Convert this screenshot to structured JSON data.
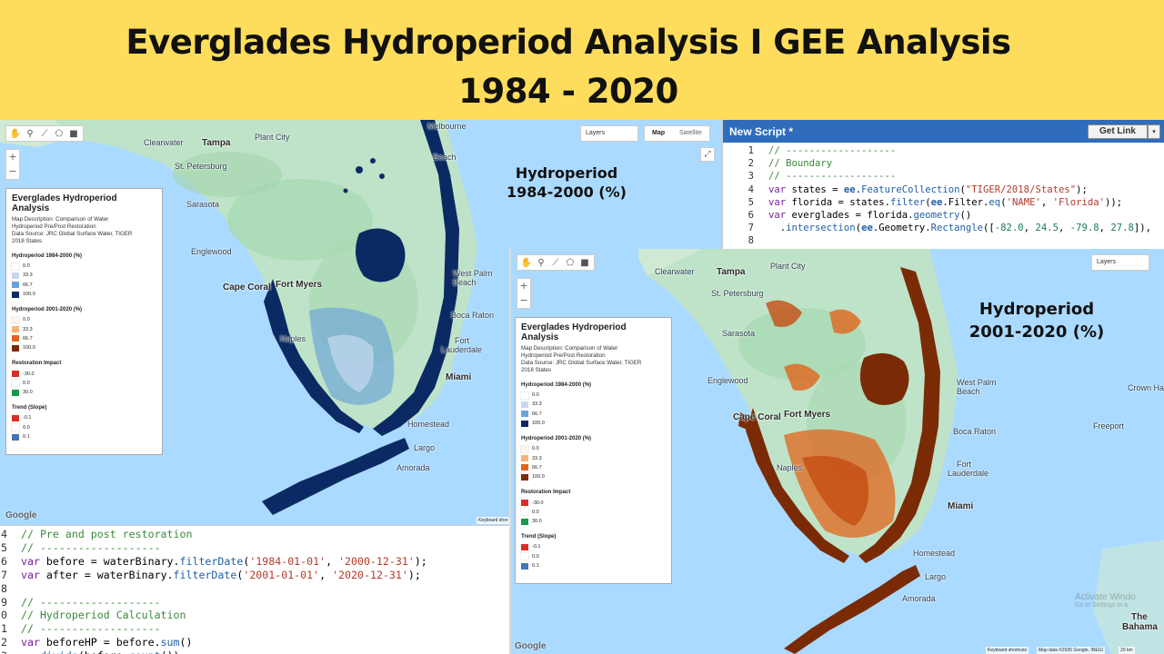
{
  "banner": {
    "title_line1": "Everglades Hydroperiod Analysis I GEE Analysis",
    "title_line2": "1984 - 2020",
    "color": "#fedd5c"
  },
  "overlay_labels": {
    "left": {
      "line1": "Hydroperiod",
      "line2": "1984-2000 (%)"
    },
    "right": {
      "line1": "Hydroperiod",
      "line2": "2001-2020 (%)"
    }
  },
  "map_ui": {
    "layers_label": "Layers",
    "map_label": "Map",
    "satellite_label": "Satellite",
    "zoom_in": "+",
    "zoom_out": "−",
    "google_logo": "Google",
    "keyboard_shortcuts": "Keyboard shortcuts",
    "keyboard_shortcuts_clipped": "Keyboard shor",
    "map_data": "Map data ©2026 Google, INEGI",
    "scale": "20 km"
  },
  "cities": {
    "left": [
      "Clearwater",
      "Tampa",
      "Plant City",
      "Melbourne",
      "St. Petersburg",
      "Sarasota",
      "Englewood",
      "Cape Coral",
      "Fort Myers",
      "Naples",
      "Beach",
      "West Palm",
      "Beach",
      "Boca Raton",
      "Fort",
      "Lauderdale",
      "Miami",
      "Largo",
      "Homestead",
      "Amorada"
    ],
    "right": [
      "Clearwater",
      "Tampa",
      "Plant City",
      "St. Petersburg",
      "Sarasota",
      "Englewood",
      "Cape Coral",
      "Fort Myers",
      "Naples",
      "West Palm",
      "Beach",
      "Boca Raton",
      "Fort",
      "Lauderdale",
      "Miami",
      "Largo",
      "Homestead",
      "Amorada",
      "Crown Have",
      "Freeport",
      "The",
      "Bahama"
    ]
  },
  "legend": {
    "title": "Everglades Hydroperiod Analysis",
    "description": [
      "Map Description: Comparison of Water",
      "Hydroperiod Pre/Post Restoration",
      "Data Source: JRC Global Surface Water, TIGER",
      "2018 States"
    ],
    "sections": [
      {
        "title": "Hydroperiod 1984-2000 (%)",
        "items": [
          {
            "label": "0.0",
            "color": "#ffffff"
          },
          {
            "label": "33.3",
            "color": "#c5d8ef"
          },
          {
            "label": "66.7",
            "color": "#6aa3d9"
          },
          {
            "label": "100.0",
            "color": "#0b2a63"
          }
        ]
      },
      {
        "title": "Hydroperiod 2001-2020 (%)",
        "items": [
          {
            "label": "0.0",
            "color": "#fff5ea"
          },
          {
            "label": "33.3",
            "color": "#f9b27a"
          },
          {
            "label": "66.7",
            "color": "#e0651c"
          },
          {
            "label": "100.0",
            "color": "#7a2b06"
          }
        ]
      },
      {
        "title": "Restoration Impact",
        "items": [
          {
            "label": "-30.0",
            "color": "#d73027"
          },
          {
            "label": "0.0",
            "color": "#ffffff"
          },
          {
            "label": "30.0",
            "color": "#1a9850"
          }
        ]
      },
      {
        "title": "Trend (Slope)",
        "items": [
          {
            "label": "-0.1",
            "color": "#d73027"
          },
          {
            "label": "0.0",
            "color": "#ffffff"
          },
          {
            "label": "0.1",
            "color": "#4575b4"
          }
        ]
      }
    ]
  },
  "script_editor": {
    "title": "New Script *",
    "get_link": "Get Link",
    "caret": "▾",
    "lines": [
      {
        "n": "1",
        "tokens": [
          [
            "c",
            "// -------------------"
          ]
        ]
      },
      {
        "n": "2",
        "tokens": [
          [
            "c",
            "// Boundary"
          ]
        ]
      },
      {
        "n": "3",
        "tokens": [
          [
            "c",
            "// -------------------"
          ]
        ]
      },
      {
        "n": "4",
        "tokens": [
          [
            "k",
            "var"
          ],
          [
            "i",
            " states = "
          ],
          [
            "e",
            "ee"
          ],
          [
            "i",
            "."
          ],
          [
            "f",
            "FeatureCollection"
          ],
          [
            "i",
            "("
          ],
          [
            "s",
            "\"TIGER/2018/States\""
          ],
          [
            "i",
            ");"
          ]
        ]
      },
      {
        "n": "5",
        "tokens": [
          [
            "k",
            "var"
          ],
          [
            "i",
            " florida = states."
          ],
          [
            "f",
            "filter"
          ],
          [
            "i",
            "("
          ],
          [
            "e",
            "ee"
          ],
          [
            "i",
            ".Filter."
          ],
          [
            "f",
            "eq"
          ],
          [
            "i",
            "("
          ],
          [
            "s",
            "'NAME'"
          ],
          [
            "i",
            ", "
          ],
          [
            "s",
            "'Florida'"
          ],
          [
            "i",
            "));"
          ]
        ]
      },
      {
        "n": "6",
        "tokens": [
          [
            "k",
            "var"
          ],
          [
            "i",
            " everglades = florida."
          ],
          [
            "f",
            "geometry"
          ],
          [
            "i",
            "()"
          ]
        ]
      },
      {
        "n": "7",
        "tokens": [
          [
            "i",
            "  ."
          ],
          [
            "f",
            "intersection"
          ],
          [
            "i",
            "("
          ],
          [
            "e",
            "ee"
          ],
          [
            "i",
            ".Geometry."
          ],
          [
            "f",
            "Rectangle"
          ],
          [
            "i",
            "(["
          ],
          [
            "n",
            "-82.0"
          ],
          [
            "i",
            ", "
          ],
          [
            "n",
            "24.5"
          ],
          [
            "i",
            ", "
          ],
          [
            "n",
            "-79.8"
          ],
          [
            "i",
            ", "
          ],
          [
            "n",
            "27.8"
          ],
          [
            "i",
            "]),"
          ]
        ]
      },
      {
        "n": "8",
        "tokens": [
          [
            "i",
            ""
          ]
        ]
      }
    ]
  },
  "code_bottom": {
    "lines": [
      {
        "n": "4",
        "tokens": [
          [
            "c",
            "// Pre and post restoration"
          ]
        ]
      },
      {
        "n": "5",
        "tokens": [
          [
            "c",
            "// -------------------"
          ]
        ]
      },
      {
        "n": "6",
        "tokens": [
          [
            "k",
            "var"
          ],
          [
            "i",
            " before = waterBinary."
          ],
          [
            "f",
            "filterDate"
          ],
          [
            "i",
            "("
          ],
          [
            "s",
            "'1984-01-01'"
          ],
          [
            "i",
            ", "
          ],
          [
            "s",
            "'2000-12-31'"
          ],
          [
            "i",
            ");"
          ]
        ]
      },
      {
        "n": "7",
        "tokens": [
          [
            "k",
            "var"
          ],
          [
            "i",
            " after = waterBinary."
          ],
          [
            "f",
            "filterDate"
          ],
          [
            "i",
            "("
          ],
          [
            "s",
            "'2001-01-01'"
          ],
          [
            "i",
            ", "
          ],
          [
            "s",
            "'2020-12-31'"
          ],
          [
            "i",
            ");"
          ]
        ]
      },
      {
        "n": "8",
        "tokens": [
          [
            "i",
            ""
          ]
        ]
      },
      {
        "n": "9",
        "tokens": [
          [
            "c",
            "// -------------------"
          ]
        ]
      },
      {
        "n": "0",
        "tokens": [
          [
            "c",
            "// Hydroperiod Calculation"
          ]
        ]
      },
      {
        "n": "1",
        "tokens": [
          [
            "c",
            "// -------------------"
          ]
        ]
      },
      {
        "n": "2",
        "tokens": [
          [
            "k",
            "var"
          ],
          [
            "i",
            " beforeHP = before."
          ],
          [
            "f",
            "sum"
          ],
          [
            "i",
            "()"
          ]
        ]
      },
      {
        "n": "3",
        "tokens": [
          [
            "i",
            "  ."
          ],
          [
            "f",
            "divide"
          ],
          [
            "i",
            "(before."
          ],
          [
            "f",
            "count"
          ],
          [
            "i",
            "())"
          ]
        ]
      }
    ]
  },
  "watermark": {
    "line1": "Activate Windo",
    "line2": "Go to Settings to a"
  },
  "colors": {
    "water": "#aadaff",
    "land": "#bfe3c8",
    "before_dark": "#0b2a63",
    "after_dark": "#7a2b06",
    "after_mid": "#c64c12",
    "header_blue": "#2f6cbc"
  }
}
